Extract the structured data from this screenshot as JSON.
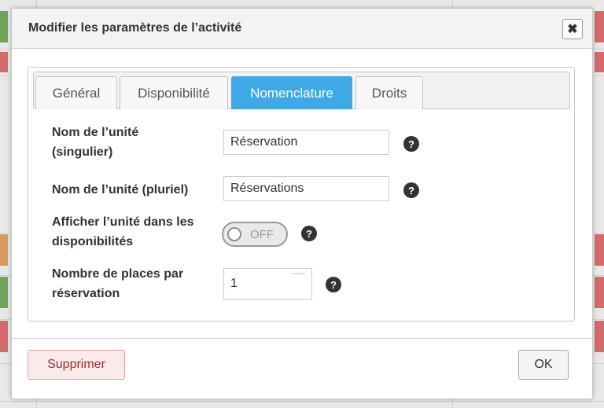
{
  "dialog": {
    "title": "Modifier les paramètres de l’activité",
    "close_icon": "✖"
  },
  "tabs": [
    {
      "label": "Général",
      "active": false
    },
    {
      "label": "Disponibilité",
      "active": false
    },
    {
      "label": "Nomenclature",
      "active": true
    },
    {
      "label": "Droits",
      "active": false
    }
  ],
  "form": {
    "unit_singular": {
      "label_line1": "Nom de l’unité",
      "label_line2": "(singulier)",
      "value": "Réservation"
    },
    "unit_plural": {
      "label": "Nom de l’unité (pluriel)",
      "value": "Réservations"
    },
    "show_unit": {
      "label_line1": "Afficher l’unité dans les",
      "label_line2": "disponibilités",
      "toggle_text": "OFF",
      "enabled": false
    },
    "places": {
      "label_line1": "Nombre de places par",
      "label_line2": "réservation",
      "value": "1"
    },
    "help_glyph": "?"
  },
  "footer": {
    "delete_label": "Supprimer",
    "ok_label": "OK"
  },
  "colors": {
    "active_tab": "#3fa9e8",
    "delete_text": "#a52a2a"
  }
}
